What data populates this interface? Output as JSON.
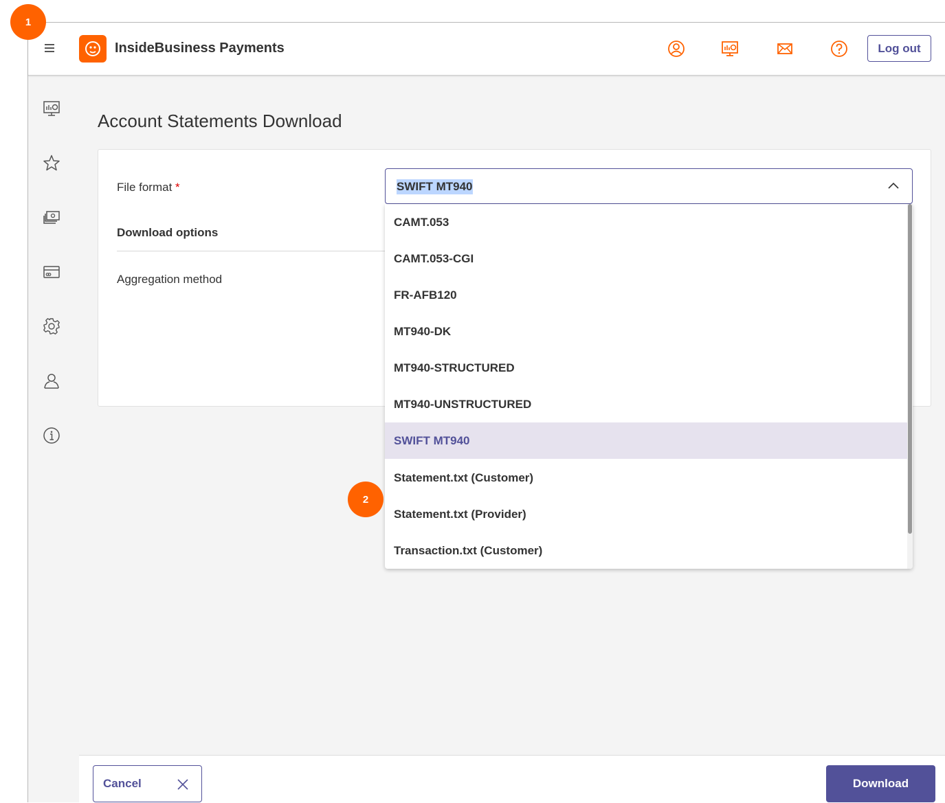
{
  "header": {
    "app_title": "InsideBusiness Payments",
    "logout_label": "Log out",
    "icons": [
      "user-circle-icon",
      "dashboard-icon",
      "mail-icon",
      "help-icon"
    ]
  },
  "sidebar": {
    "icons": [
      "dashboard-icon",
      "star-icon",
      "payments-icon",
      "card-icon",
      "gear-icon",
      "user-icon",
      "info-icon"
    ]
  },
  "page": {
    "title": "Account Statements Download"
  },
  "form": {
    "file_format_label": "File format",
    "required_marker": "*",
    "download_options_label": "Download options",
    "aggregation_label": "Aggregation method",
    "selected_value": "SWIFT MT940"
  },
  "dropdown": {
    "options": [
      "CAMT.053",
      "CAMT.053-CGI",
      "FR-AFB120",
      "MT940-DK",
      "MT940-STRUCTURED",
      "MT940-UNSTRUCTURED",
      "SWIFT MT940",
      "Statement.txt (Customer)",
      "Statement.txt (Provider)",
      "Transaction.txt (Customer)"
    ],
    "selected_index": 6
  },
  "footer": {
    "cancel_label": "Cancel",
    "download_label": "Download"
  },
  "badges": {
    "first": "1",
    "second": "2"
  },
  "colors": {
    "brand_orange": "#ff6200",
    "accent_purple": "#525199",
    "selected_row": "#e6e2ee"
  }
}
